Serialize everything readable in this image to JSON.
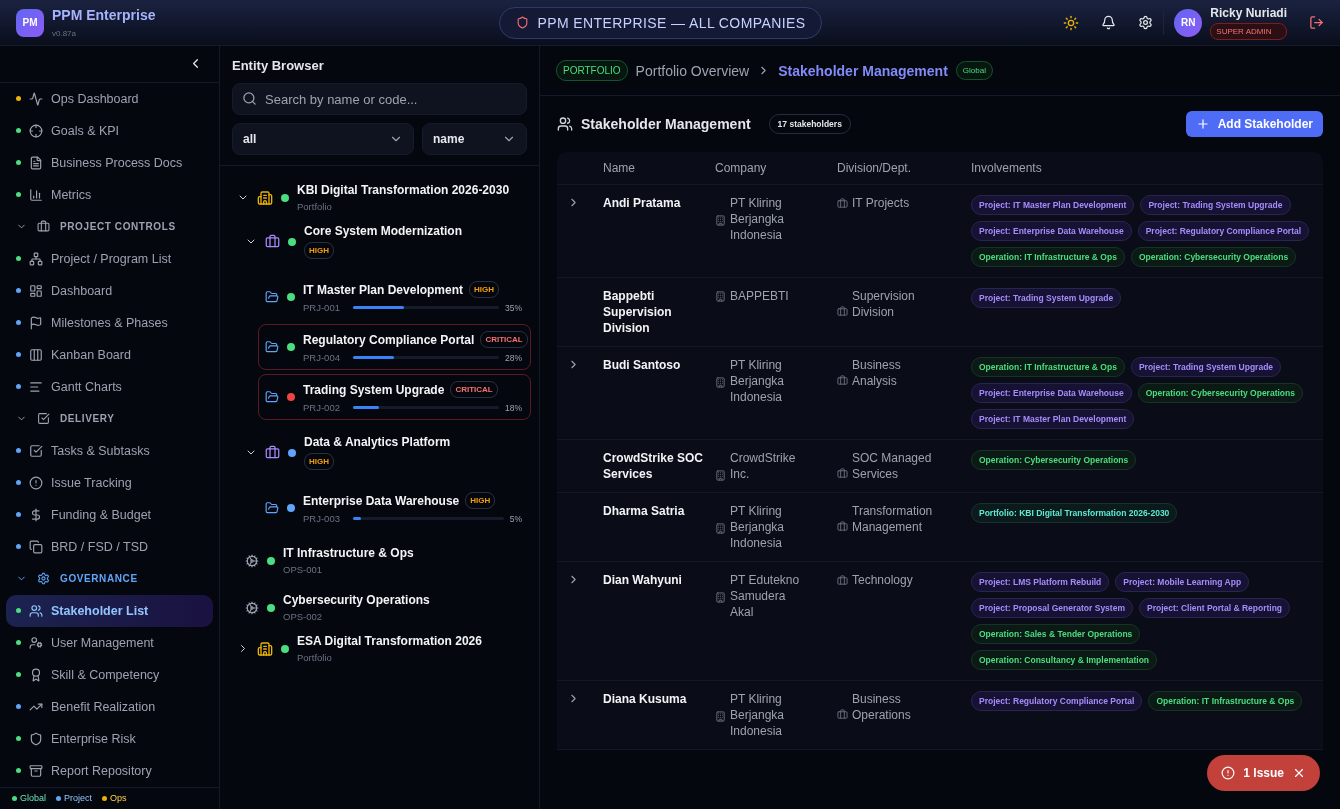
{
  "app": {
    "logo": "PM",
    "title": "PPM Enterprise",
    "version": "v0.87a"
  },
  "scope": {
    "label": "PPM ENTERPRISE — ALL COMPANIES"
  },
  "user": {
    "initials": "RN",
    "name": "Ricky Nuriadi",
    "role": "SUPER ADMIN"
  },
  "sidebar": {
    "items": [
      {
        "kind": "item",
        "label": "Ops Dashboard",
        "color": "#eab308",
        "selected": false
      },
      {
        "kind": "item",
        "label": "Goals & KPI",
        "color": "#4ade80",
        "selected": false
      },
      {
        "kind": "item",
        "label": "Business Process Docs",
        "color": "#4ade80",
        "selected": false
      },
      {
        "kind": "item",
        "label": "Metrics",
        "color": "#4ade80",
        "selected": false
      },
      {
        "kind": "section",
        "label": "PROJECT CONTROLS",
        "expanded": true,
        "selected": false
      },
      {
        "kind": "item",
        "label": "Project / Program List",
        "color": "#4ade80",
        "selected": false
      },
      {
        "kind": "item",
        "label": "Dashboard",
        "color": "#60a5fa",
        "selected": false
      },
      {
        "kind": "item",
        "label": "Milestones & Phases",
        "color": "#60a5fa",
        "selected": false
      },
      {
        "kind": "item",
        "label": "Kanban Board",
        "color": "#60a5fa",
        "selected": false
      },
      {
        "kind": "item",
        "label": "Gantt Charts",
        "color": "#60a5fa",
        "selected": false
      },
      {
        "kind": "section",
        "label": "DELIVERY",
        "expanded": true,
        "selected": false
      },
      {
        "kind": "item",
        "label": "Tasks & Subtasks",
        "color": "#60a5fa",
        "selected": false
      },
      {
        "kind": "item",
        "label": "Issue Tracking",
        "color": "#60a5fa",
        "selected": false
      },
      {
        "kind": "item",
        "label": "Funding & Budget",
        "color": "#60a5fa",
        "selected": false
      },
      {
        "kind": "item",
        "label": "BRD / FSD / TSD",
        "color": "#60a5fa",
        "selected": false
      },
      {
        "kind": "section",
        "label": "GOVERNANCE",
        "expanded": true,
        "selected": true
      },
      {
        "kind": "item",
        "label": "Stakeholder List",
        "color": "#4ade80",
        "selected": true
      },
      {
        "kind": "item",
        "label": "User Management",
        "color": "#4ade80",
        "selected": false
      },
      {
        "kind": "item",
        "label": "Skill & Competency",
        "color": "#4ade80",
        "selected": false
      },
      {
        "kind": "item",
        "label": "Benefit Realization",
        "color": "#60a5fa",
        "selected": false
      },
      {
        "kind": "item",
        "label": "Enterprise Risk",
        "color": "#4ade80",
        "selected": false
      },
      {
        "kind": "item",
        "label": "Report Repository",
        "color": "#4ade80",
        "selected": false
      }
    ],
    "legend": [
      {
        "label": "Global",
        "color": "#4ade80"
      },
      {
        "label": "Project",
        "color": "#60a5fa"
      },
      {
        "label": "Ops",
        "color": "#eab308"
      }
    ]
  },
  "entity_browser": {
    "title": "Entity Browser",
    "search": {
      "placeholder": "Search by name or code..."
    },
    "filters": [
      {
        "value": "all"
      },
      {
        "value": "name"
      }
    ],
    "tree": [
      {
        "kind": "portfolio",
        "name": "KBI Digital Transformation 2026-2030",
        "subtitle": "Portfolio",
        "color": "#4ade80",
        "expanded": true,
        "children": [
          {
            "kind": "program",
            "name": "Core System Modernization",
            "color": "#4ade80",
            "priority": "HIGH",
            "critical": false,
            "expanded": true,
            "children": [
              {
                "kind": "project",
                "name": "IT Master Plan Development",
                "priority": "HIGH",
                "critical": false,
                "code": "PRJ-001",
                "color": "#4ade80",
                "level": 0.35,
                "reading": "35%"
              },
              {
                "kind": "project",
                "name": "Regulatory Compliance Portal",
                "priority": "CRITICAL",
                "critical": true,
                "code": "PRJ-004",
                "color": "#4ade80",
                "level": 0.28,
                "reading": "28%"
              },
              {
                "kind": "project",
                "name": "Trading System Upgrade",
                "priority": "CRITICAL",
                "critical": true,
                "code": "PRJ-002",
                "color": "#ef4444",
                "level": 0.18,
                "reading": "18%"
              }
            ]
          },
          {
            "kind": "program",
            "name": "Data & Analytics Platform",
            "color": "#60a5fa",
            "priority": "HIGH",
            "critical": false,
            "expanded": true,
            "children": [
              {
                "kind": "project",
                "name": "Enterprise Data Warehouse",
                "priority": "HIGH",
                "critical": false,
                "code": "PRJ-003",
                "color": "#60a5fa",
                "level": 0.05,
                "reading": "5%"
              }
            ]
          },
          {
            "kind": "operation",
            "name": "IT Infrastructure & Ops",
            "subtitle": "OPS-001",
            "color": "#4ade80"
          },
          {
            "kind": "operation",
            "name": "Cybersecurity Operations",
            "subtitle": "OPS-002",
            "color": "#4ade80"
          }
        ]
      },
      {
        "kind": "portfolio",
        "name": "ESA Digital Transformation 2026",
        "subtitle": "Portfolio",
        "color": "#4ade80",
        "expanded": false
      }
    ]
  },
  "breadcrumb": {
    "badge": "PORTFOLIO",
    "items": [
      {
        "label": "Portfolio Overview",
        "selected": false
      },
      {
        "label": "Stakeholder Management",
        "selected": true
      }
    ],
    "scope": "Global"
  },
  "page": {
    "title": "Stakeholder Management",
    "count": "17 stakeholders",
    "add_button": "Add Stakeholder"
  },
  "table": {
    "columns": [
      "Name",
      "Company",
      "Division/Dept.",
      "Involvements"
    ],
    "rows": [
      {
        "expandable": true,
        "name": "Andi Pratama",
        "company": "PT Kliring Berjangka Indonesia",
        "division": "IT Projects",
        "involvements": [
          {
            "kind": "project",
            "label": "Project: IT Master Plan Development"
          },
          {
            "kind": "project",
            "label": "Project: Trading System Upgrade"
          },
          {
            "kind": "project",
            "label": "Project: Enterprise Data Warehouse"
          },
          {
            "kind": "project",
            "label": "Project: Regulatory Compliance Portal"
          },
          {
            "kind": "operation",
            "label": "Operation: IT Infrastructure & Ops"
          },
          {
            "kind": "operation",
            "label": "Operation: Cybersecurity Operations"
          }
        ]
      },
      {
        "expandable": false,
        "name": "Bappebti Supervision Division",
        "company": "BAPPEBTI",
        "division": "Supervision Division",
        "involvements": [
          {
            "kind": "project",
            "label": "Project: Trading System Upgrade"
          }
        ]
      },
      {
        "expandable": true,
        "name": "Budi Santoso",
        "company": "PT Kliring Berjangka Indonesia",
        "division": "Business Analysis",
        "involvements": [
          {
            "kind": "operation",
            "label": "Operation: IT Infrastructure & Ops"
          },
          {
            "kind": "project",
            "label": "Project: Trading System Upgrade"
          },
          {
            "kind": "project",
            "label": "Project: Enterprise Data Warehouse"
          },
          {
            "kind": "operation",
            "label": "Operation: Cybersecurity Operations"
          },
          {
            "kind": "project",
            "label": "Project: IT Master Plan Development"
          }
        ]
      },
      {
        "expandable": false,
        "name": "CrowdStrike SOC Services",
        "company": "CrowdStrike Inc.",
        "division": "SOC Managed Services",
        "involvements": [
          {
            "kind": "operation",
            "label": "Operation: Cybersecurity Operations"
          }
        ]
      },
      {
        "expandable": false,
        "name": "Dharma Satria",
        "company": "PT Kliring Berjangka Indonesia",
        "division": "Transformation Management",
        "involvements": [
          {
            "kind": "portfolio",
            "label": "Portfolio: KBI Digital Transformation 2026-2030"
          }
        ]
      },
      {
        "expandable": true,
        "name": "Dian Wahyuni",
        "company": "PT Edutekno Samudera Akal",
        "division": "Technology",
        "involvements": [
          {
            "kind": "project",
            "label": "Project: LMS Platform Rebuild"
          },
          {
            "kind": "project",
            "label": "Project: Mobile Learning App"
          },
          {
            "kind": "project",
            "label": "Project: Proposal Generator System"
          },
          {
            "kind": "project",
            "label": "Project: Client Portal & Reporting"
          },
          {
            "kind": "operation",
            "label": "Operation: Sales & Tender Operations"
          },
          {
            "kind": "operation",
            "label": "Operation: Consultancy & Implementation"
          }
        ]
      },
      {
        "expandable": true,
        "name": "Diana Kusuma",
        "company": "PT Kliring Berjangka Indonesia",
        "division": "Business Operations",
        "involvements": [
          {
            "kind": "project",
            "label": "Project: Regulatory Compliance Portal"
          },
          {
            "kind": "operation",
            "label": "Operation: IT Infrastructure & Ops"
          }
        ]
      }
    ]
  },
  "issue_toast": {
    "label": "1 Issue"
  }
}
